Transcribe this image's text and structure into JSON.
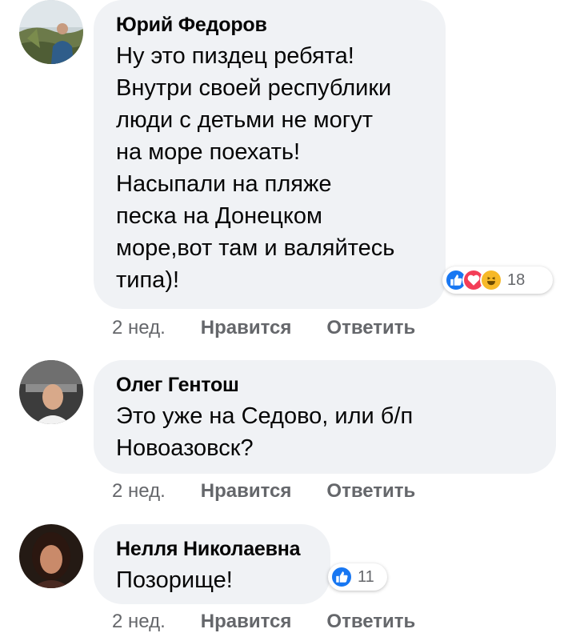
{
  "comments": [
    {
      "author": "Юрий Федоров",
      "text": "Ну это пиздец ребята!\nВнутри своей республики\nлюди с детьми не могут\nна море поехать!\nНасыпали на пляже\nпеска на Донецком\nморе,вот там и валяйтесь\nтипа)!",
      "reactions": {
        "icons": [
          "like-icon",
          "love-icon",
          "haha-icon"
        ],
        "count": "18"
      },
      "time": "2 нед.",
      "like_label": "Нравится",
      "reply_label": "Ответить"
    },
    {
      "author": "Олег Гентош",
      "text": "Это уже на Седово, или б/п\nНовоазовск?",
      "time": "2 нед.",
      "like_label": "Нравится",
      "reply_label": "Ответить"
    },
    {
      "author": "Нелля Николаевна",
      "text": "Позорище!",
      "reactions": {
        "icons": [
          "like-icon"
        ],
        "count": "11"
      },
      "time": "2 нед.",
      "like_label": "Нравится",
      "reply_label": "Ответить"
    }
  ],
  "colors": {
    "bubble": "#f0f2f5",
    "meta": "#65676b",
    "like": "#1877f2",
    "love": "#f33e58",
    "haha": "#f7b928"
  }
}
